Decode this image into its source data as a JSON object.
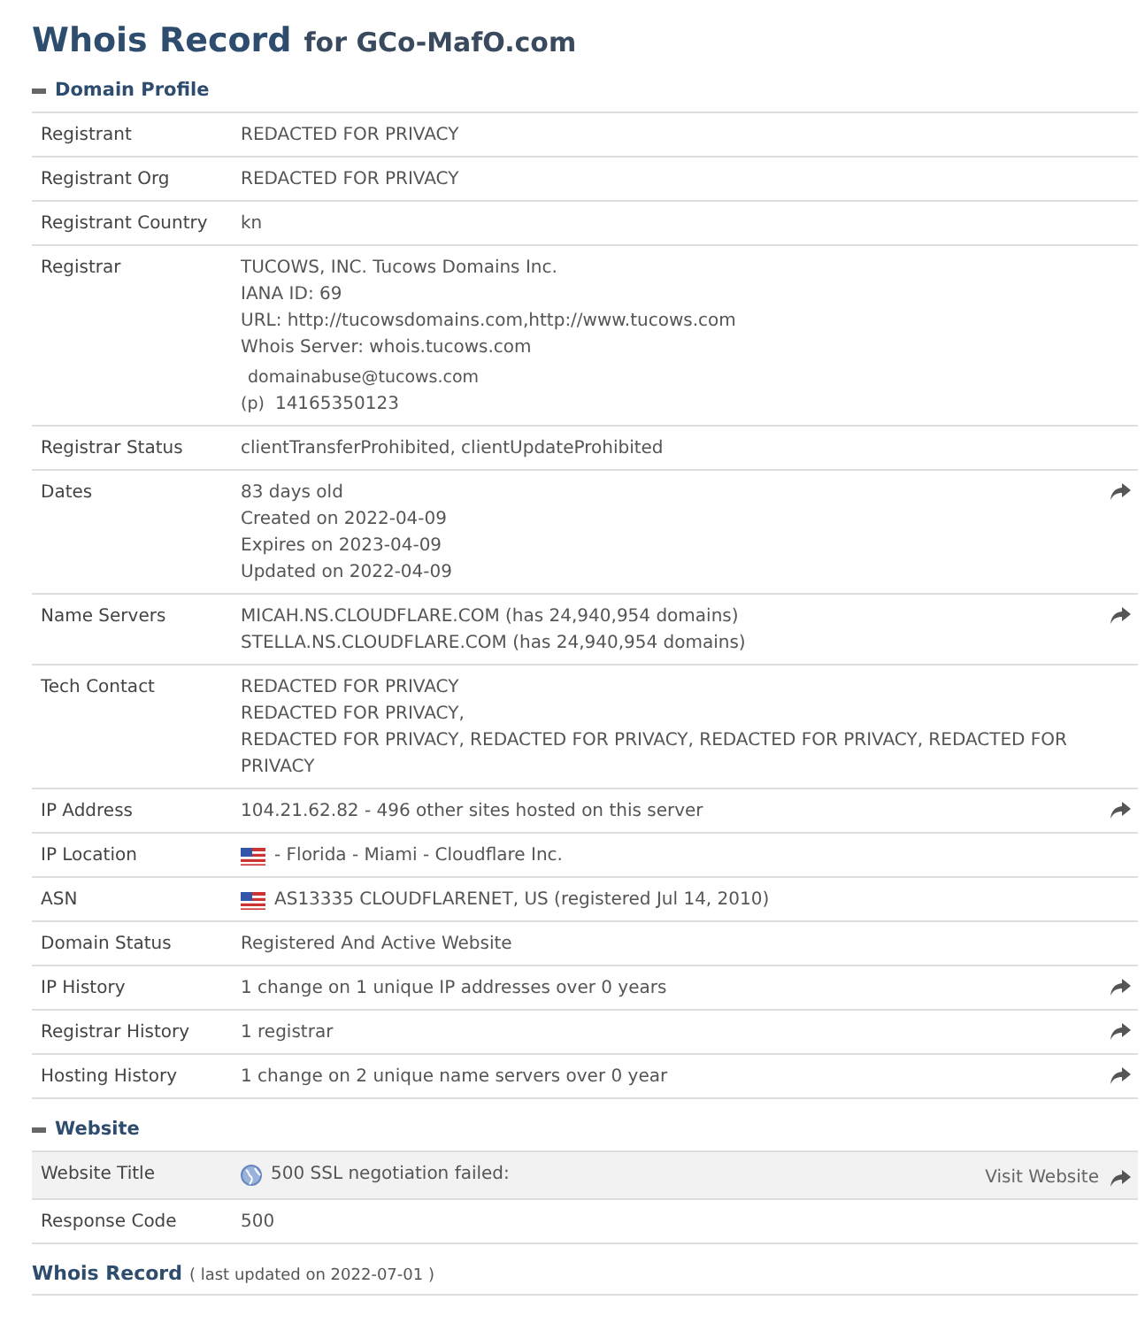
{
  "title": {
    "main": "Whois Record",
    "sub": "for GCo-MafO.com"
  },
  "sections": [
    {
      "heading": "Domain Profile",
      "expanded": true,
      "rows": [
        {
          "label": "Registrant",
          "lines": [
            "REDACTED FOR PRIVACY"
          ],
          "link": false,
          "shaded": false
        },
        {
          "label": "Registrant Org",
          "lines": [
            "REDACTED FOR PRIVACY"
          ],
          "link": false,
          "shaded": false
        },
        {
          "label": "Registrant Country",
          "lines": [
            "kn"
          ],
          "link": false,
          "shaded": false
        },
        {
          "label": "Registrar",
          "lines": [
            "TUCOWS, INC. Tucows Domains Inc.",
            "IANA ID: 69",
            "URL: http://tucowsdomains.com,http://www.tucows.com",
            "Whois Server: whois.tucows.com"
          ],
          "contact": {
            "email": "domainabuse@tucows.com",
            "phone_label": "(p)",
            "phone": "14165350123"
          },
          "link": false,
          "shaded": false
        },
        {
          "label": "Registrar Status",
          "lines": [
            "clientTransferProhibited, clientUpdateProhibited"
          ],
          "link": false,
          "shaded": false
        },
        {
          "label": "Dates",
          "lines": [
            "83 days old",
            "Created on 2022-04-09",
            "Expires on 2023-04-09",
            "Updated on 2022-04-09"
          ],
          "link": true,
          "shaded": false
        },
        {
          "label": "Name Servers",
          "lines": [
            "MICAH.NS.CLOUDFLARE.COM (has 24,940,954 domains)",
            "STELLA.NS.CLOUDFLARE.COM (has 24,940,954 domains)"
          ],
          "link": true,
          "shaded": false
        },
        {
          "label": "Tech Contact",
          "lines": [
            "REDACTED FOR PRIVACY",
            "REDACTED FOR PRIVACY,",
            "REDACTED FOR PRIVACY, REDACTED FOR PRIVACY, REDACTED FOR PRIVACY, REDACTED FOR PRIVACY"
          ],
          "link": false,
          "shaded": false
        },
        {
          "label": "IP Address",
          "lines": [
            "104.21.62.82 - 496 other sites hosted on this server"
          ],
          "link": true,
          "shaded": false
        },
        {
          "label": "IP Location",
          "kind": "flag",
          "lines": [
            "- Florida - Miami - Cloudflare Inc."
          ],
          "link": false,
          "shaded": false
        },
        {
          "label": "ASN",
          "kind": "flag",
          "lines": [
            "AS13335 CLOUDFLARENET, US (registered Jul 14, 2010)"
          ],
          "link": false,
          "shaded": false
        },
        {
          "label": "Domain Status",
          "lines": [
            "Registered And Active Website"
          ],
          "link": false,
          "shaded": false
        },
        {
          "label": "IP History",
          "lines": [
            "1 change on 1 unique IP addresses over 0 years"
          ],
          "link": true,
          "shaded": false
        },
        {
          "label": "Registrar History",
          "lines": [
            "1 registrar"
          ],
          "link": true,
          "shaded": false
        },
        {
          "label": "Hosting History",
          "lines": [
            "1 change on 2 unique name servers over 0 year"
          ],
          "link": true,
          "shaded": false
        }
      ]
    },
    {
      "heading": "Website",
      "expanded": true,
      "rows": [
        {
          "label": "Website Title",
          "kind": "globe",
          "lines": [
            "500 SSL negotiation failed:"
          ],
          "action": "Visit Website",
          "link": true,
          "shaded": true
        },
        {
          "label": "Response Code",
          "lines": [
            "500"
          ],
          "link": false,
          "shaded": false
        }
      ]
    }
  ],
  "footer": {
    "title": "Whois Record",
    "note": "( last updated on 2022-07-01 )"
  }
}
